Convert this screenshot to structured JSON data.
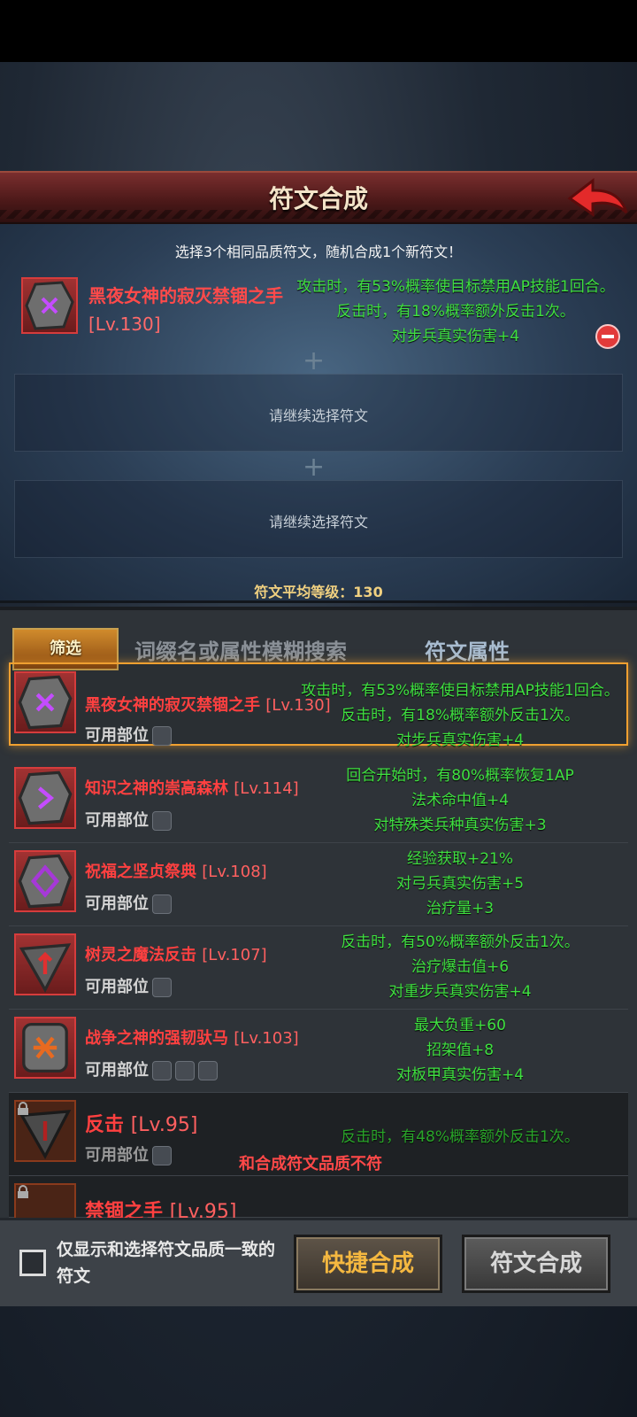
{
  "header": {
    "title": "符文合成"
  },
  "instruction": "选择3个相同品质符文，随机合成1个新符文！",
  "selected_slot": {
    "name": "黑夜女神的寂灭禁锢之手",
    "level": "[Lv.130]",
    "effects": [
      "攻击时，有53%概率使目标禁用AP技能1回合。",
      "反击时，有18%概率额外反击1次。",
      "对步兵真实伤害+4"
    ]
  },
  "empty_slot_text": "请继续选择符文",
  "average_level": "符文平均等级：130",
  "filter": {
    "button_label": "筛选",
    "search_placeholder": "词缀名或属性模糊搜索",
    "attr_tab": "符文属性"
  },
  "parts_label": "可用部位",
  "runes": [
    {
      "name": "黑夜女神的寂灭禁锢之手",
      "level": "[Lv.130]",
      "effects": [
        "攻击时，有53%概率使目标禁用AP技能1回合。",
        "反击时，有18%概率额外反击1次。",
        "对步兵真实伤害+4"
      ]
    },
    {
      "name": "知识之神的崇高森林",
      "level": "[Lv.114]",
      "effects": [
        "回合开始时，有80%概率恢复1AP",
        "法术命中值+4",
        "对特殊类兵种真实伤害+3"
      ]
    },
    {
      "name": "祝福之坚贞祭典",
      "level": "[Lv.108]",
      "effects": [
        "经验获取+21%",
        "对弓兵真实伤害+5",
        "治疗量+3"
      ]
    },
    {
      "name": "树灵之魔法反击",
      "level": "[Lv.107]",
      "effects": [
        "反击时，有50%概率额外反击1次。",
        "治疗爆击值+6",
        "对重步兵真实伤害+4"
      ]
    },
    {
      "name": "战争之神的强韧驮马",
      "level": "[Lv.103]",
      "effects": [
        "最大负重+60",
        "招架值+8",
        "对板甲真实伤害+4"
      ]
    },
    {
      "name": "反击",
      "level": "[Lv.95]",
      "effects": [
        "反击时，有48%概率额外反击1次。"
      ],
      "note": "和合成符文品质不符"
    },
    {
      "name": "禁锢之手",
      "level": "[Lv.95]"
    }
  ],
  "bottom": {
    "checkbox_label": "仅显示和选择符文品质一致的符文",
    "quick_button": "快捷合成",
    "synth_button": "符文合成"
  },
  "colors": {
    "rune_name": "#ff4040",
    "effect_text": "#3fe040",
    "gold": "#f5b840"
  }
}
